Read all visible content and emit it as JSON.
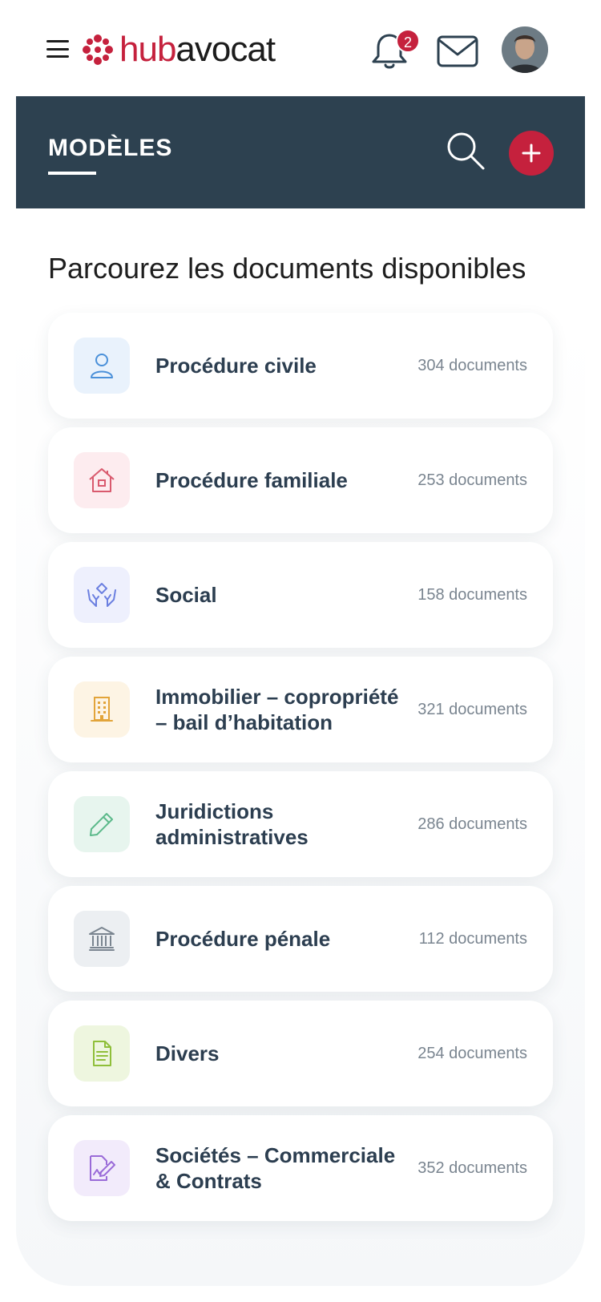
{
  "header": {
    "logo_hub": "hub",
    "logo_avocat": "avocat",
    "notification_count": "2"
  },
  "section": {
    "title": "MODÈLES"
  },
  "heading": "Parcourez les documents disponibles",
  "categories": [
    {
      "label": "Procédure civile",
      "count": "304 documents",
      "icon": "person-icon",
      "color": "#4a90d9",
      "bg": "#e9f2fc"
    },
    {
      "label": "Procédure familiale",
      "count": "253 documents",
      "icon": "house-icon",
      "color": "#d95a6e",
      "bg": "#fdecef"
    },
    {
      "label": "Social",
      "count": "158 documents",
      "icon": "helping-hands-icon",
      "color": "#6b7fe0",
      "bg": "#eef0fd"
    },
    {
      "label": "Immobilier – copropriété – bail d’habitation",
      "count": "321 documents",
      "icon": "building-icon",
      "color": "#e2a43a",
      "bg": "#fdf4e4"
    },
    {
      "label": "Juridictions administratives",
      "count": "286 documents",
      "icon": "pencil-icon",
      "color": "#5bb98a",
      "bg": "#e7f5ee"
    },
    {
      "label": "Procédure pénale",
      "count": "112 documents",
      "icon": "courthouse-icon",
      "color": "#7a8590",
      "bg": "#eceff2"
    },
    {
      "label": "Divers",
      "count": "254 documents",
      "icon": "document-icon",
      "color": "#8fbf3a",
      "bg": "#eef6df"
    },
    {
      "label": "Sociétés – Commerciale & Contrats",
      "count": "352 documents",
      "icon": "contract-signature-icon",
      "color": "#9a6bd8",
      "bg": "#f2ebfb"
    }
  ]
}
